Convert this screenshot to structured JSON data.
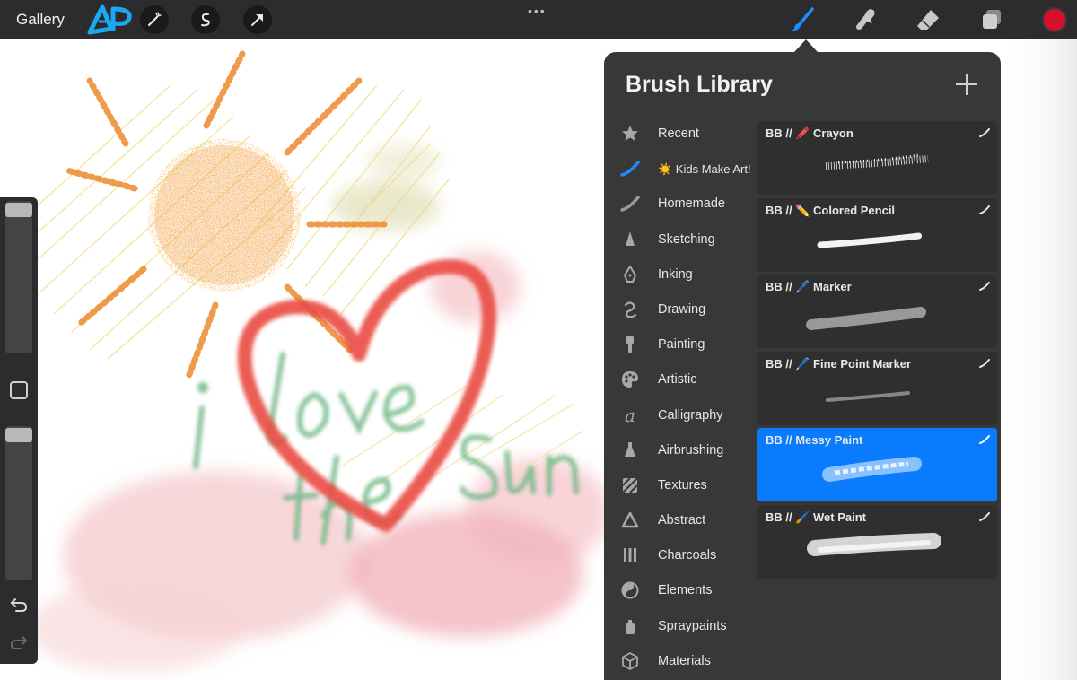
{
  "topbar": {
    "gallery_label": "Gallery",
    "more_label": "•••",
    "tools": [
      "adjustments-icon",
      "selection-icon",
      "transform-icon"
    ],
    "right_tools": [
      "brush-icon",
      "smudge-icon",
      "eraser-icon",
      "layers-icon"
    ],
    "active_tool": "brush-icon",
    "brush_active_color": "#1e8cff",
    "current_color": "#d5102a"
  },
  "canvas": {
    "text_lines": [
      "i",
      "Love",
      "the",
      "Sun"
    ]
  },
  "sidebar": {
    "brush_size_level": 0.02,
    "opacity_level": 0.03
  },
  "brush_library": {
    "title": "Brush Library",
    "add_label": "+",
    "categories": [
      {
        "label": "Recent",
        "icon": "star-icon"
      },
      {
        "label": "☀️ Kids Make Art!",
        "icon": "blue-stroke-icon",
        "active": true
      },
      {
        "label": "Homemade",
        "icon": "stroke-icon"
      },
      {
        "label": "Sketching",
        "icon": "pencil-tip-icon"
      },
      {
        "label": "Inking",
        "icon": "pen-nib-icon"
      },
      {
        "label": "Drawing",
        "icon": "squiggle-icon"
      },
      {
        "label": "Painting",
        "icon": "paint-brush-icon"
      },
      {
        "label": "Artistic",
        "icon": "palette-icon"
      },
      {
        "label": "Calligraphy",
        "icon": "calligraphy-icon"
      },
      {
        "label": "Airbrushing",
        "icon": "airbrush-icon"
      },
      {
        "label": "Textures",
        "icon": "hatch-icon"
      },
      {
        "label": "Abstract",
        "icon": "triangle-icon"
      },
      {
        "label": "Charcoals",
        "icon": "charcoal-icon"
      },
      {
        "label": "Elements",
        "icon": "yin-yang-icon"
      },
      {
        "label": "Spraypaints",
        "icon": "spray-can-icon"
      },
      {
        "label": "Materials",
        "icon": "cube-icon"
      }
    ],
    "brushes": [
      {
        "name": "BB // 🖍️ Crayon",
        "selected": false
      },
      {
        "name": "BB // ✏️ Colored Pencil",
        "selected": false
      },
      {
        "name": "BB // 🖊️ Marker",
        "selected": false
      },
      {
        "name": "BB // 🖊️ Fine Point Marker",
        "selected": false
      },
      {
        "name": "BB // Messy Paint",
        "selected": true
      },
      {
        "name": "BB // 🖌️ Wet Paint",
        "selected": false
      }
    ],
    "selected_color": "#0a7bfc"
  }
}
